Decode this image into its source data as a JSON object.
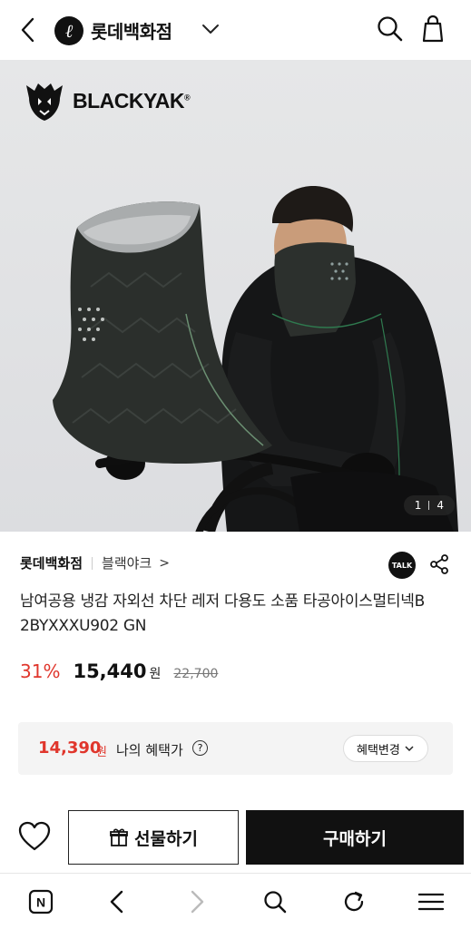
{
  "header": {
    "brand_initial": "ℓ",
    "brand_name": "롯데백화점"
  },
  "hero": {
    "logo_text": "BLACKYAK",
    "logo_mark": "®",
    "pager_current": "1",
    "pager_total": "4"
  },
  "product": {
    "store": "롯데백화점",
    "brand": "블랙야크",
    "brand_chevron": ">",
    "talk_label": "TALK",
    "title": "남여공용 냉감 자외선 차단 레저 다용도 소품 타공아이스멀티넥B 2BYXXXU902 GN",
    "discount": "31%",
    "price": "15,440",
    "won": "원",
    "original_price": "22,700"
  },
  "benefit": {
    "price": "14,390",
    "won": "원",
    "label": "나의 혜택가",
    "help": "?",
    "change_label": "혜택변경"
  },
  "actions": {
    "gift_label": "선물하기",
    "buy_label": "구매하기"
  },
  "browser": {
    "home_letter": "N"
  },
  "colors": {
    "accent_red": "#e0362c",
    "primary_black": "#111111"
  }
}
